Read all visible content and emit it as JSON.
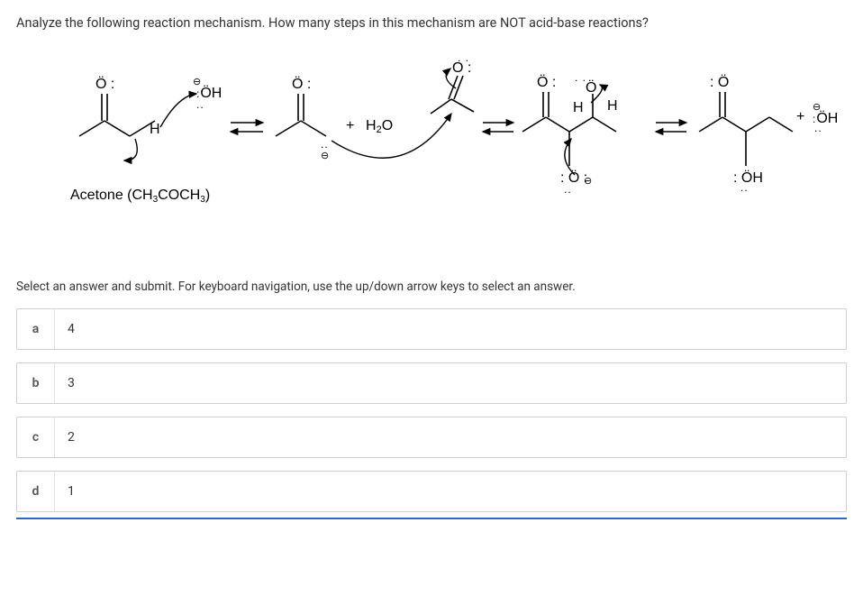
{
  "question": "Analyze the following reaction mechanism. How many steps in this mechanism are NOT acid-base reactions?",
  "diagram": {
    "start_label": "Acetone (CH₃COCH₃)",
    "hydroxide": "OH",
    "water": "H₂O",
    "plus": "+"
  },
  "instruction": "Select an answer and submit. For keyboard navigation, use the up/down arrow keys to select an answer.",
  "options": [
    {
      "letter": "a",
      "text": "4"
    },
    {
      "letter": "b",
      "text": "3"
    },
    {
      "letter": "c",
      "text": "2"
    },
    {
      "letter": "d",
      "text": "1"
    }
  ]
}
